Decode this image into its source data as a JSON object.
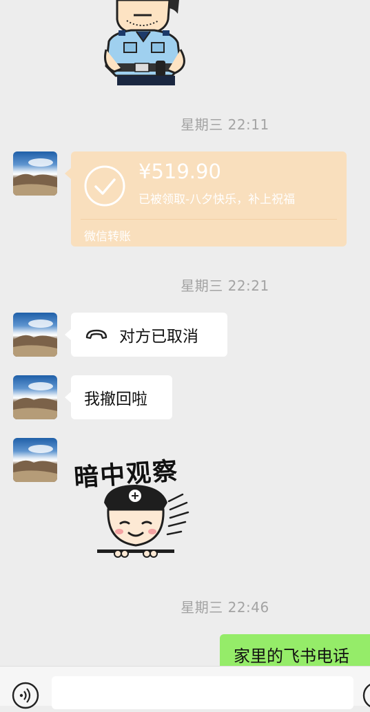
{
  "chat": {
    "timestamps": [
      "星期三 22:11",
      "星期三 22:21",
      "星期三 22:46"
    ],
    "transfer": {
      "amount": "¥519.90",
      "note": "已被领取-八夕快乐，补上祝福",
      "footer": "微信转账"
    },
    "call_status": "对方已取消",
    "recalled_message": "我撤回啦",
    "sticker_caption": "暗中观察",
    "sent_message": "家里的飞书电话"
  },
  "colors": {
    "background": "#ededed",
    "transfer_bubble": "#f9dfbd",
    "sent_bubble": "#95ec69",
    "timestamp_text": "#a3a3a3"
  },
  "icons": {
    "transfer": "check-circle-icon",
    "call": "phone-icon",
    "voice": "voice-icon"
  }
}
